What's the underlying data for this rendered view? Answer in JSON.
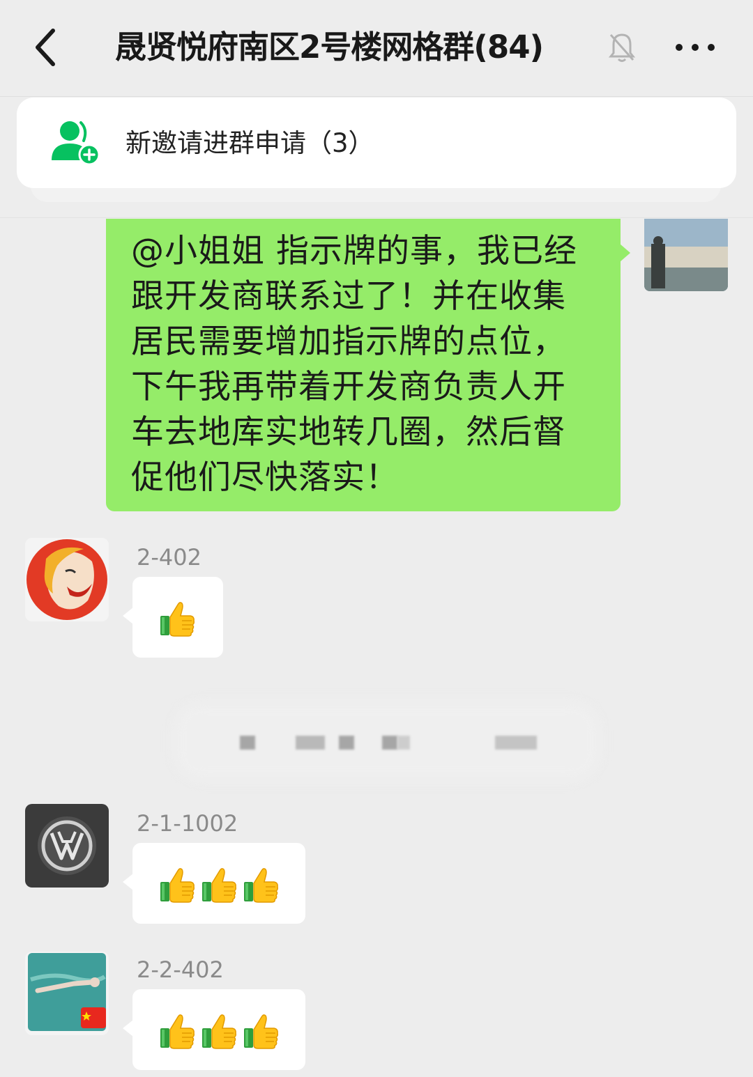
{
  "header": {
    "title": "晟贤悦府南区2号楼网格群(84)",
    "back_icon": "chevron-left-icon",
    "mute_icon": "bell-muted-icon",
    "more_icon": "ellipsis-icon"
  },
  "invite_banner": {
    "icon": "add-contact-icon",
    "label": "新邀请进群申请（3）"
  },
  "messages": [
    {
      "direction": "outgoing",
      "text": "@小姐姐  指示牌的事，我已经跟开发商联系过了！并在收集居民需要增加指示牌的点位，下午我再带着开发商负责人开车去地库实地转几圈，然后督促他们尽快落实！",
      "lines": [
        "@小姐姐  指示牌的事，我已经",
        "跟开发商联系过了！并在收集",
        "居民需要增加指示牌的点位，",
        "下午我再带着开发商负责人开",
        "车去地库实地转几圈，然后督",
        "促他们尽快落实！"
      ]
    },
    {
      "direction": "incoming",
      "sender": "2-402",
      "emoji": "thumbs-up-icon",
      "count": 1
    },
    {
      "direction": "incoming",
      "sender": "2-1-1002",
      "emoji": "thumbs-up-icon",
      "count": 3
    },
    {
      "direction": "incoming",
      "sender": "2-2-402",
      "emoji": "thumbs-up-icon",
      "count": 3
    }
  ],
  "colors": {
    "background": "#ededed",
    "outgoing_bubble": "#95ec69",
    "incoming_bubble": "#ffffff",
    "accent_green": "#07c160",
    "sender_gray": "#8a8a8a"
  }
}
